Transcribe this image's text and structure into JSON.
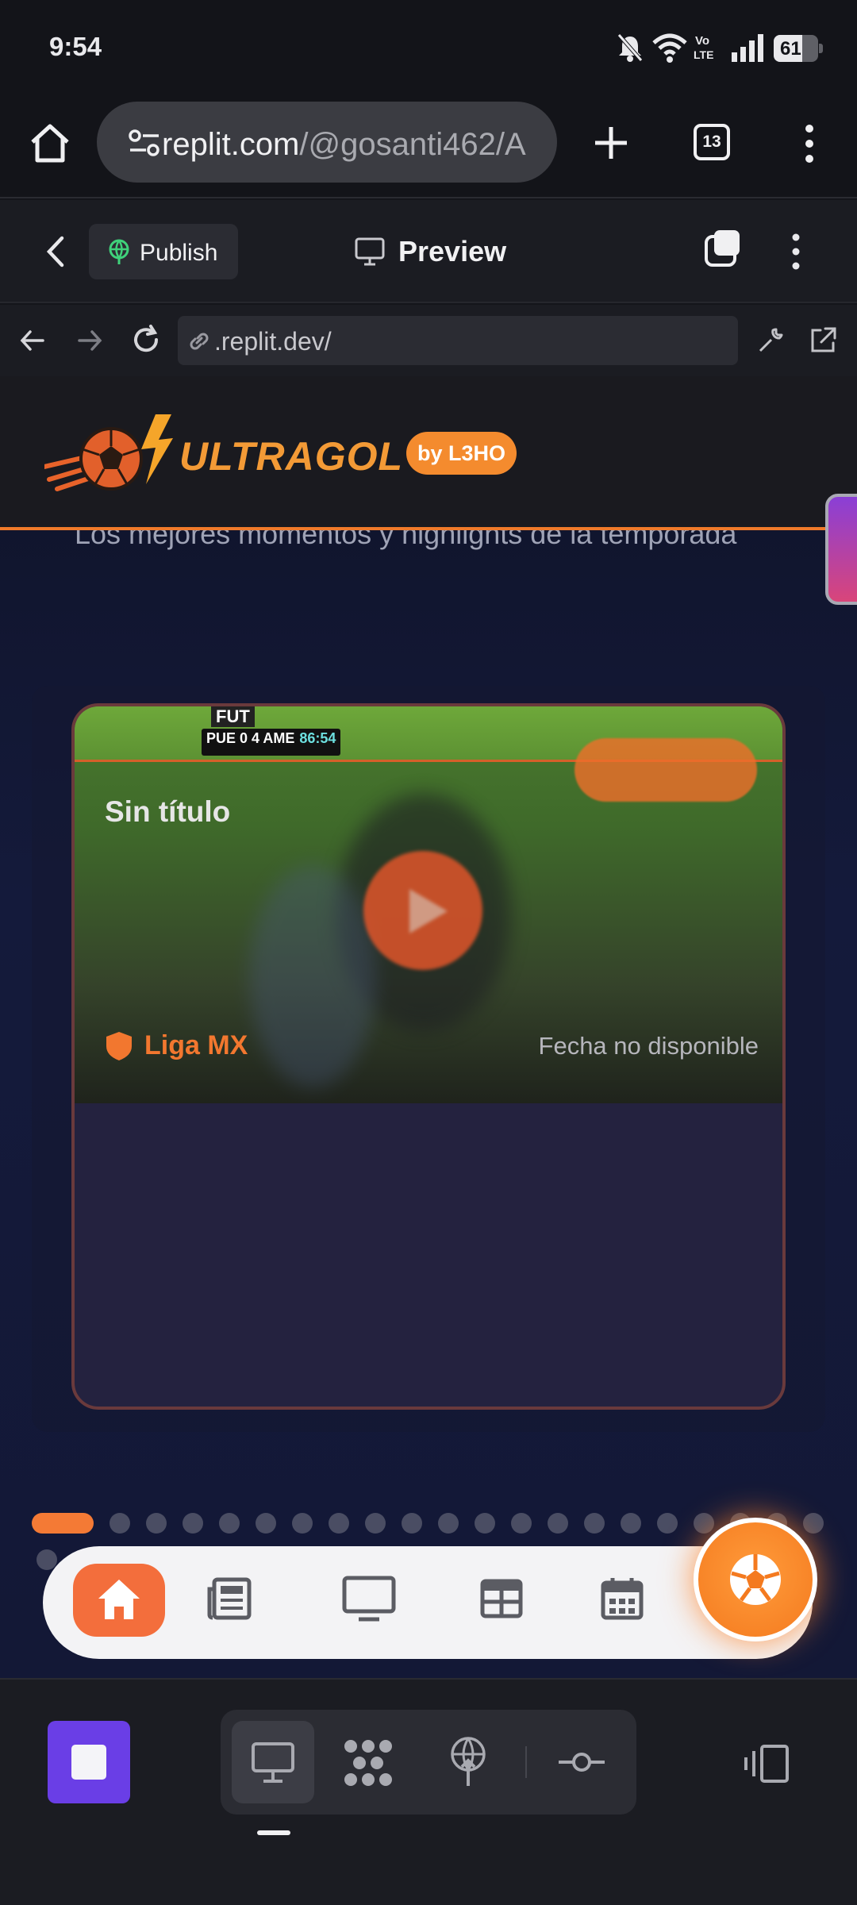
{
  "status_bar": {
    "time": "9:54",
    "battery": "61"
  },
  "browser": {
    "url_main": "replit.com",
    "url_rest": "/@gosanti462/A",
    "tab_count": "13"
  },
  "replit_header": {
    "publish_label": "Publish",
    "title": "Preview"
  },
  "webview": {
    "address": ".replit.dev/"
  },
  "site": {
    "logo": "ULTRAGOL",
    "badge": "by L3HO",
    "subtitle": "Los mejores momentos y highlights de la temporada",
    "card": {
      "scoreboard": "PUE 0 4 AME",
      "clock": "86:54",
      "overlay_tag": "FUT",
      "title": "Sin título",
      "league": "Liga MX",
      "date": "Fecha no disponible"
    },
    "carousel": {
      "active_index": 0
    },
    "nav": [
      "home",
      "news",
      "tv",
      "grid",
      "calendar"
    ]
  },
  "colors": {
    "accent": "#f47a35",
    "replit_purple": "#6a3ee6",
    "page_bg": "#141a3b"
  }
}
